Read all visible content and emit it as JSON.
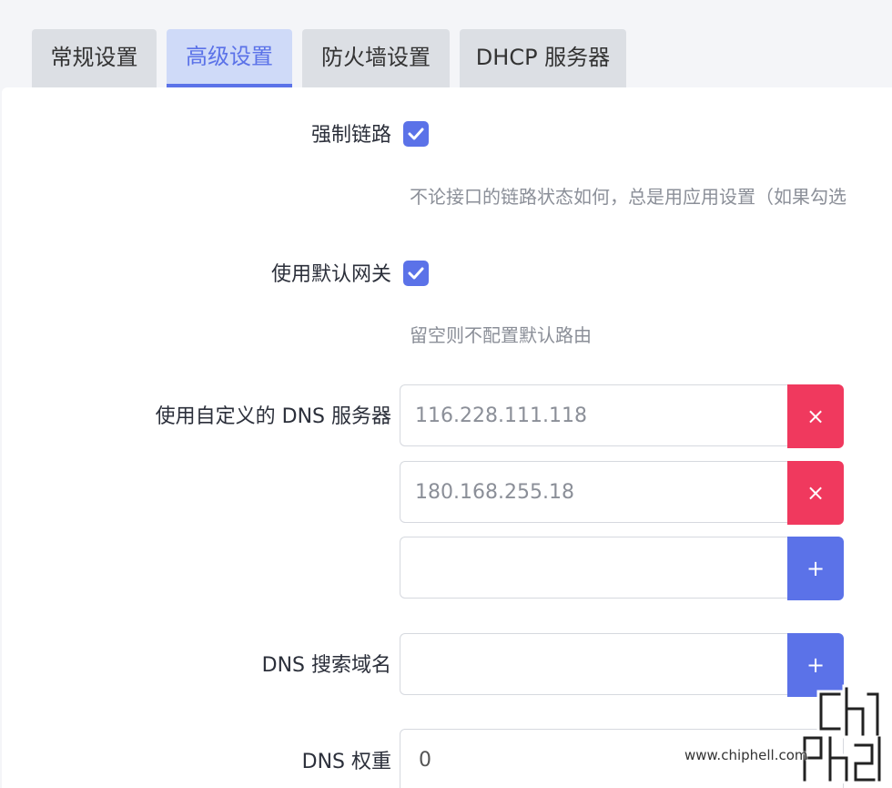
{
  "tabs": [
    {
      "label": "常规设置",
      "active": false
    },
    {
      "label": "高级设置",
      "active": true
    },
    {
      "label": "防火墙设置",
      "active": false
    },
    {
      "label": "DHCP 服务器",
      "active": false
    }
  ],
  "force_link": {
    "label": "强制链路",
    "checked": true,
    "description": "不论接口的链路状态如何，总是用应用设置（如果勾选"
  },
  "default_gateway": {
    "label": "使用默认网关",
    "checked": true,
    "description": "留空则不配置默认路由"
  },
  "custom_dns": {
    "label": "使用自定义的 DNS 服务器",
    "entries": [
      {
        "value": "116.228.111.118",
        "button": "×"
      },
      {
        "value": "180.168.255.18",
        "button": "×"
      },
      {
        "value": "",
        "button": "+"
      }
    ]
  },
  "dns_search": {
    "label": "DNS 搜索域名",
    "value": "",
    "button": "+"
  },
  "dns_weight": {
    "label": "DNS 权重",
    "value": "0"
  },
  "watermark": {
    "text": "www.chiphell.com"
  },
  "colors": {
    "accent": "#5b72e8",
    "danger": "#f0395e",
    "tab_inactive": "#dcdfe4",
    "tab_active_bg": "#cfdaf8"
  }
}
